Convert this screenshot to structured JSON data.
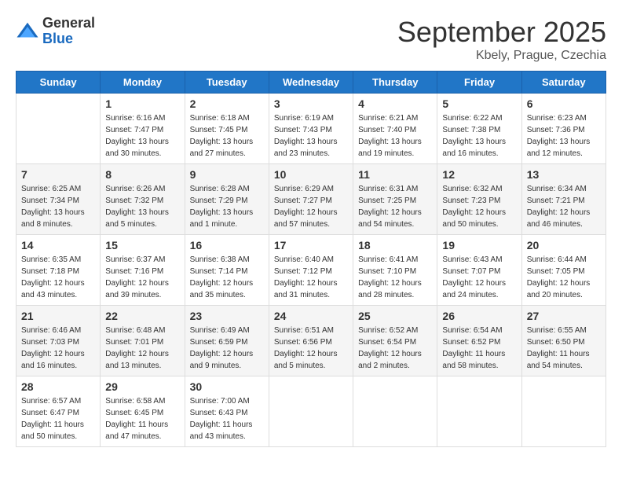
{
  "logo": {
    "general": "General",
    "blue": "Blue"
  },
  "title": "September 2025",
  "location": "Kbely, Prague, Czechia",
  "days_of_week": [
    "Sunday",
    "Monday",
    "Tuesday",
    "Wednesday",
    "Thursday",
    "Friday",
    "Saturday"
  ],
  "weeks": [
    [
      {
        "day": "",
        "sunrise": "",
        "sunset": "",
        "daylight": ""
      },
      {
        "day": "1",
        "sunrise": "Sunrise: 6:16 AM",
        "sunset": "Sunset: 7:47 PM",
        "daylight": "Daylight: 13 hours and 30 minutes."
      },
      {
        "day": "2",
        "sunrise": "Sunrise: 6:18 AM",
        "sunset": "Sunset: 7:45 PM",
        "daylight": "Daylight: 13 hours and 27 minutes."
      },
      {
        "day": "3",
        "sunrise": "Sunrise: 6:19 AM",
        "sunset": "Sunset: 7:43 PM",
        "daylight": "Daylight: 13 hours and 23 minutes."
      },
      {
        "day": "4",
        "sunrise": "Sunrise: 6:21 AM",
        "sunset": "Sunset: 7:40 PM",
        "daylight": "Daylight: 13 hours and 19 minutes."
      },
      {
        "day": "5",
        "sunrise": "Sunrise: 6:22 AM",
        "sunset": "Sunset: 7:38 PM",
        "daylight": "Daylight: 13 hours and 16 minutes."
      },
      {
        "day": "6",
        "sunrise": "Sunrise: 6:23 AM",
        "sunset": "Sunset: 7:36 PM",
        "daylight": "Daylight: 13 hours and 12 minutes."
      }
    ],
    [
      {
        "day": "7",
        "sunrise": "Sunrise: 6:25 AM",
        "sunset": "Sunset: 7:34 PM",
        "daylight": "Daylight: 13 hours and 8 minutes."
      },
      {
        "day": "8",
        "sunrise": "Sunrise: 6:26 AM",
        "sunset": "Sunset: 7:32 PM",
        "daylight": "Daylight: 13 hours and 5 minutes."
      },
      {
        "day": "9",
        "sunrise": "Sunrise: 6:28 AM",
        "sunset": "Sunset: 7:29 PM",
        "daylight": "Daylight: 13 hours and 1 minute."
      },
      {
        "day": "10",
        "sunrise": "Sunrise: 6:29 AM",
        "sunset": "Sunset: 7:27 PM",
        "daylight": "Daylight: 12 hours and 57 minutes."
      },
      {
        "day": "11",
        "sunrise": "Sunrise: 6:31 AM",
        "sunset": "Sunset: 7:25 PM",
        "daylight": "Daylight: 12 hours and 54 minutes."
      },
      {
        "day": "12",
        "sunrise": "Sunrise: 6:32 AM",
        "sunset": "Sunset: 7:23 PM",
        "daylight": "Daylight: 12 hours and 50 minutes."
      },
      {
        "day": "13",
        "sunrise": "Sunrise: 6:34 AM",
        "sunset": "Sunset: 7:21 PM",
        "daylight": "Daylight: 12 hours and 46 minutes."
      }
    ],
    [
      {
        "day": "14",
        "sunrise": "Sunrise: 6:35 AM",
        "sunset": "Sunset: 7:18 PM",
        "daylight": "Daylight: 12 hours and 43 minutes."
      },
      {
        "day": "15",
        "sunrise": "Sunrise: 6:37 AM",
        "sunset": "Sunset: 7:16 PM",
        "daylight": "Daylight: 12 hours and 39 minutes."
      },
      {
        "day": "16",
        "sunrise": "Sunrise: 6:38 AM",
        "sunset": "Sunset: 7:14 PM",
        "daylight": "Daylight: 12 hours and 35 minutes."
      },
      {
        "day": "17",
        "sunrise": "Sunrise: 6:40 AM",
        "sunset": "Sunset: 7:12 PM",
        "daylight": "Daylight: 12 hours and 31 minutes."
      },
      {
        "day": "18",
        "sunrise": "Sunrise: 6:41 AM",
        "sunset": "Sunset: 7:10 PM",
        "daylight": "Daylight: 12 hours and 28 minutes."
      },
      {
        "day": "19",
        "sunrise": "Sunrise: 6:43 AM",
        "sunset": "Sunset: 7:07 PM",
        "daylight": "Daylight: 12 hours and 24 minutes."
      },
      {
        "day": "20",
        "sunrise": "Sunrise: 6:44 AM",
        "sunset": "Sunset: 7:05 PM",
        "daylight": "Daylight: 12 hours and 20 minutes."
      }
    ],
    [
      {
        "day": "21",
        "sunrise": "Sunrise: 6:46 AM",
        "sunset": "Sunset: 7:03 PM",
        "daylight": "Daylight: 12 hours and 16 minutes."
      },
      {
        "day": "22",
        "sunrise": "Sunrise: 6:48 AM",
        "sunset": "Sunset: 7:01 PM",
        "daylight": "Daylight: 12 hours and 13 minutes."
      },
      {
        "day": "23",
        "sunrise": "Sunrise: 6:49 AM",
        "sunset": "Sunset: 6:59 PM",
        "daylight": "Daylight: 12 hours and 9 minutes."
      },
      {
        "day": "24",
        "sunrise": "Sunrise: 6:51 AM",
        "sunset": "Sunset: 6:56 PM",
        "daylight": "Daylight: 12 hours and 5 minutes."
      },
      {
        "day": "25",
        "sunrise": "Sunrise: 6:52 AM",
        "sunset": "Sunset: 6:54 PM",
        "daylight": "Daylight: 12 hours and 2 minutes."
      },
      {
        "day": "26",
        "sunrise": "Sunrise: 6:54 AM",
        "sunset": "Sunset: 6:52 PM",
        "daylight": "Daylight: 11 hours and 58 minutes."
      },
      {
        "day": "27",
        "sunrise": "Sunrise: 6:55 AM",
        "sunset": "Sunset: 6:50 PM",
        "daylight": "Daylight: 11 hours and 54 minutes."
      }
    ],
    [
      {
        "day": "28",
        "sunrise": "Sunrise: 6:57 AM",
        "sunset": "Sunset: 6:47 PM",
        "daylight": "Daylight: 11 hours and 50 minutes."
      },
      {
        "day": "29",
        "sunrise": "Sunrise: 6:58 AM",
        "sunset": "Sunset: 6:45 PM",
        "daylight": "Daylight: 11 hours and 47 minutes."
      },
      {
        "day": "30",
        "sunrise": "Sunrise: 7:00 AM",
        "sunset": "Sunset: 6:43 PM",
        "daylight": "Daylight: 11 hours and 43 minutes."
      },
      {
        "day": "",
        "sunrise": "",
        "sunset": "",
        "daylight": ""
      },
      {
        "day": "",
        "sunrise": "",
        "sunset": "",
        "daylight": ""
      },
      {
        "day": "",
        "sunrise": "",
        "sunset": "",
        "daylight": ""
      },
      {
        "day": "",
        "sunrise": "",
        "sunset": "",
        "daylight": ""
      }
    ]
  ]
}
